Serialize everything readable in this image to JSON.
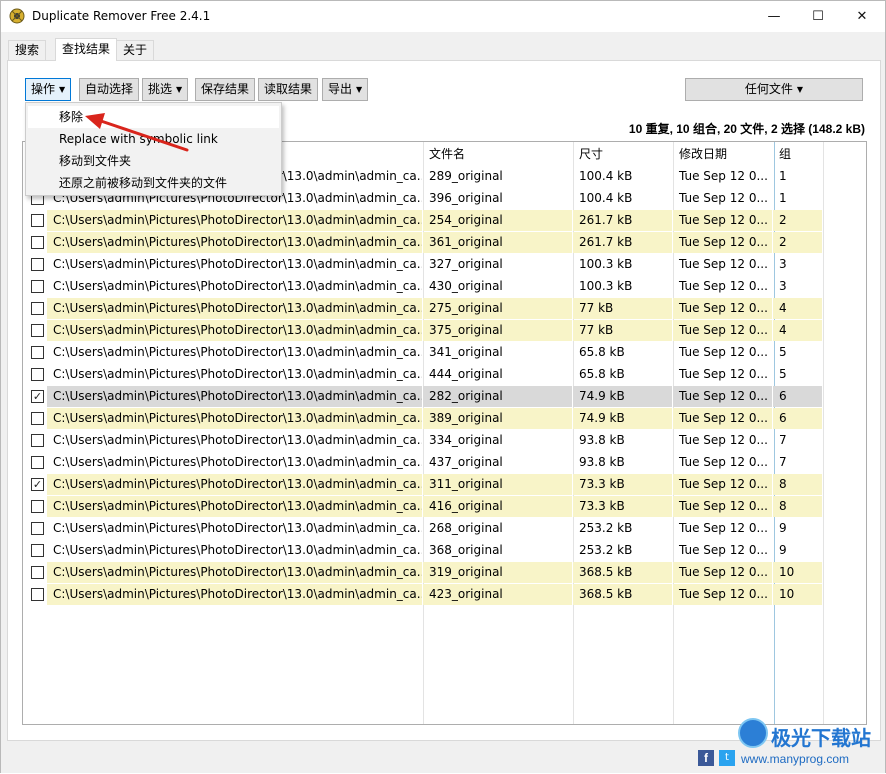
{
  "window": {
    "title": "Duplicate Remover Free 2.4.1",
    "controls": {
      "minimize": "—",
      "maximize": "☐",
      "close": "✕"
    }
  },
  "tabs": [
    {
      "label": "搜索",
      "active": false
    },
    {
      "label": "查找结果",
      "active": true
    },
    {
      "label": "关于",
      "active": false
    }
  ],
  "toolbar": {
    "actions_label": "操作",
    "auto_select_label": "自动选择",
    "pick_label": "挑选",
    "save_results_label": "保存结果",
    "load_results_label": "读取结果",
    "export_label": "导出",
    "file_filter_label": "任何文件"
  },
  "summary": "10 重复, 10 组合, 20 文件, 2 选择 (148.2 kB)",
  "menu": {
    "items": [
      {
        "label": "移除",
        "highlighted": true
      },
      {
        "label": "Replace with symbolic link",
        "highlighted": false
      },
      {
        "label": "移动到文件夹",
        "highlighted": false
      },
      {
        "label": "还原之前被移动到文件夹的文件",
        "highlighted": false
      }
    ]
  },
  "table": {
    "columns": [
      "",
      "文件名",
      "尺寸",
      "修改日期",
      "组"
    ],
    "rows": [
      {
        "checked": false,
        "highlight": false,
        "selected": false,
        "path": "C:\\Users\\admin\\Pictures\\PhotoDirector\\13.0\\admin\\admin_ca...",
        "name": "289_original",
        "size": "100.4 kB",
        "date": "Tue Sep 12 0...",
        "group": "1"
      },
      {
        "checked": false,
        "highlight": false,
        "selected": false,
        "path": "C:\\Users\\admin\\Pictures\\PhotoDirector\\13.0\\admin\\admin_ca...",
        "name": "396_original",
        "size": "100.4 kB",
        "date": "Tue Sep 12 0...",
        "group": "1"
      },
      {
        "checked": false,
        "highlight": true,
        "selected": false,
        "path": "C:\\Users\\admin\\Pictures\\PhotoDirector\\13.0\\admin\\admin_ca...",
        "name": "254_original",
        "size": "261.7 kB",
        "date": "Tue Sep 12 0...",
        "group": "2"
      },
      {
        "checked": false,
        "highlight": true,
        "selected": false,
        "path": "C:\\Users\\admin\\Pictures\\PhotoDirector\\13.0\\admin\\admin_ca...",
        "name": "361_original",
        "size": "261.7 kB",
        "date": "Tue Sep 12 0...",
        "group": "2"
      },
      {
        "checked": false,
        "highlight": false,
        "selected": false,
        "path": "C:\\Users\\admin\\Pictures\\PhotoDirector\\13.0\\admin\\admin_ca...",
        "name": "327_original",
        "size": "100.3 kB",
        "date": "Tue Sep 12 0...",
        "group": "3"
      },
      {
        "checked": false,
        "highlight": false,
        "selected": false,
        "path": "C:\\Users\\admin\\Pictures\\PhotoDirector\\13.0\\admin\\admin_ca...",
        "name": "430_original",
        "size": "100.3 kB",
        "date": "Tue Sep 12 0...",
        "group": "3"
      },
      {
        "checked": false,
        "highlight": true,
        "selected": false,
        "path": "C:\\Users\\admin\\Pictures\\PhotoDirector\\13.0\\admin\\admin_ca...",
        "name": "275_original",
        "size": "77 kB",
        "date": "Tue Sep 12 0...",
        "group": "4"
      },
      {
        "checked": false,
        "highlight": true,
        "selected": false,
        "path": "C:\\Users\\admin\\Pictures\\PhotoDirector\\13.0\\admin\\admin_ca...",
        "name": "375_original",
        "size": "77 kB",
        "date": "Tue Sep 12 0...",
        "group": "4"
      },
      {
        "checked": false,
        "highlight": false,
        "selected": false,
        "path": "C:\\Users\\admin\\Pictures\\PhotoDirector\\13.0\\admin\\admin_ca...",
        "name": "341_original",
        "size": "65.8 kB",
        "date": "Tue Sep 12 0...",
        "group": "5"
      },
      {
        "checked": false,
        "highlight": false,
        "selected": false,
        "path": "C:\\Users\\admin\\Pictures\\PhotoDirector\\13.0\\admin\\admin_ca...",
        "name": "444_original",
        "size": "65.8 kB",
        "date": "Tue Sep 12 0...",
        "group": "5"
      },
      {
        "checked": true,
        "highlight": false,
        "selected": true,
        "path": "C:\\Users\\admin\\Pictures\\PhotoDirector\\13.0\\admin\\admin_ca...",
        "name": "282_original",
        "size": "74.9 kB",
        "date": "Tue Sep 12 0...",
        "group": "6"
      },
      {
        "checked": false,
        "highlight": true,
        "selected": false,
        "path": "C:\\Users\\admin\\Pictures\\PhotoDirector\\13.0\\admin\\admin_ca...",
        "name": "389_original",
        "size": "74.9 kB",
        "date": "Tue Sep 12 0...",
        "group": "6"
      },
      {
        "checked": false,
        "highlight": false,
        "selected": false,
        "path": "C:\\Users\\admin\\Pictures\\PhotoDirector\\13.0\\admin\\admin_ca...",
        "name": "334_original",
        "size": "93.8 kB",
        "date": "Tue Sep 12 0...",
        "group": "7"
      },
      {
        "checked": false,
        "highlight": false,
        "selected": false,
        "path": "C:\\Users\\admin\\Pictures\\PhotoDirector\\13.0\\admin\\admin_ca...",
        "name": "437_original",
        "size": "93.8 kB",
        "date": "Tue Sep 12 0...",
        "group": "7"
      },
      {
        "checked": true,
        "highlight": true,
        "selected": false,
        "path": "C:\\Users\\admin\\Pictures\\PhotoDirector\\13.0\\admin\\admin_ca...",
        "name": "311_original",
        "size": "73.3 kB",
        "date": "Tue Sep 12 0...",
        "group": "8"
      },
      {
        "checked": false,
        "highlight": true,
        "selected": false,
        "path": "C:\\Users\\admin\\Pictures\\PhotoDirector\\13.0\\admin\\admin_ca...",
        "name": "416_original",
        "size": "73.3 kB",
        "date": "Tue Sep 12 0...",
        "group": "8"
      },
      {
        "checked": false,
        "highlight": false,
        "selected": false,
        "path": "C:\\Users\\admin\\Pictures\\PhotoDirector\\13.0\\admin\\admin_ca...",
        "name": "268_original",
        "size": "253.2 kB",
        "date": "Tue Sep 12 0...",
        "group": "9"
      },
      {
        "checked": false,
        "highlight": false,
        "selected": false,
        "path": "C:\\Users\\admin\\Pictures\\PhotoDirector\\13.0\\admin\\admin_ca...",
        "name": "368_original",
        "size": "253.2 kB",
        "date": "Tue Sep 12 0...",
        "group": "9"
      },
      {
        "checked": false,
        "highlight": true,
        "selected": false,
        "path": "C:\\Users\\admin\\Pictures\\PhotoDirector\\13.0\\admin\\admin_ca...",
        "name": "319_original",
        "size": "368.5 kB",
        "date": "Tue Sep 12 0...",
        "group": "10"
      },
      {
        "checked": false,
        "highlight": true,
        "selected": false,
        "path": "C:\\Users\\admin\\Pictures\\PhotoDirector\\13.0\\admin\\admin_ca...",
        "name": "423_original",
        "size": "368.5 kB",
        "date": "Tue Sep 12 0...",
        "group": "10"
      }
    ]
  },
  "footer": {
    "facebook_icon": "f",
    "twitter_icon": "t"
  },
  "watermark": {
    "title": "极光下载站",
    "url": "www.manyprog.com"
  },
  "colors": {
    "highlight_row": "#f8f4c8",
    "selected_row": "#d9d9d9",
    "arrow": "#d9251c",
    "focus_border": "#0078d7"
  }
}
